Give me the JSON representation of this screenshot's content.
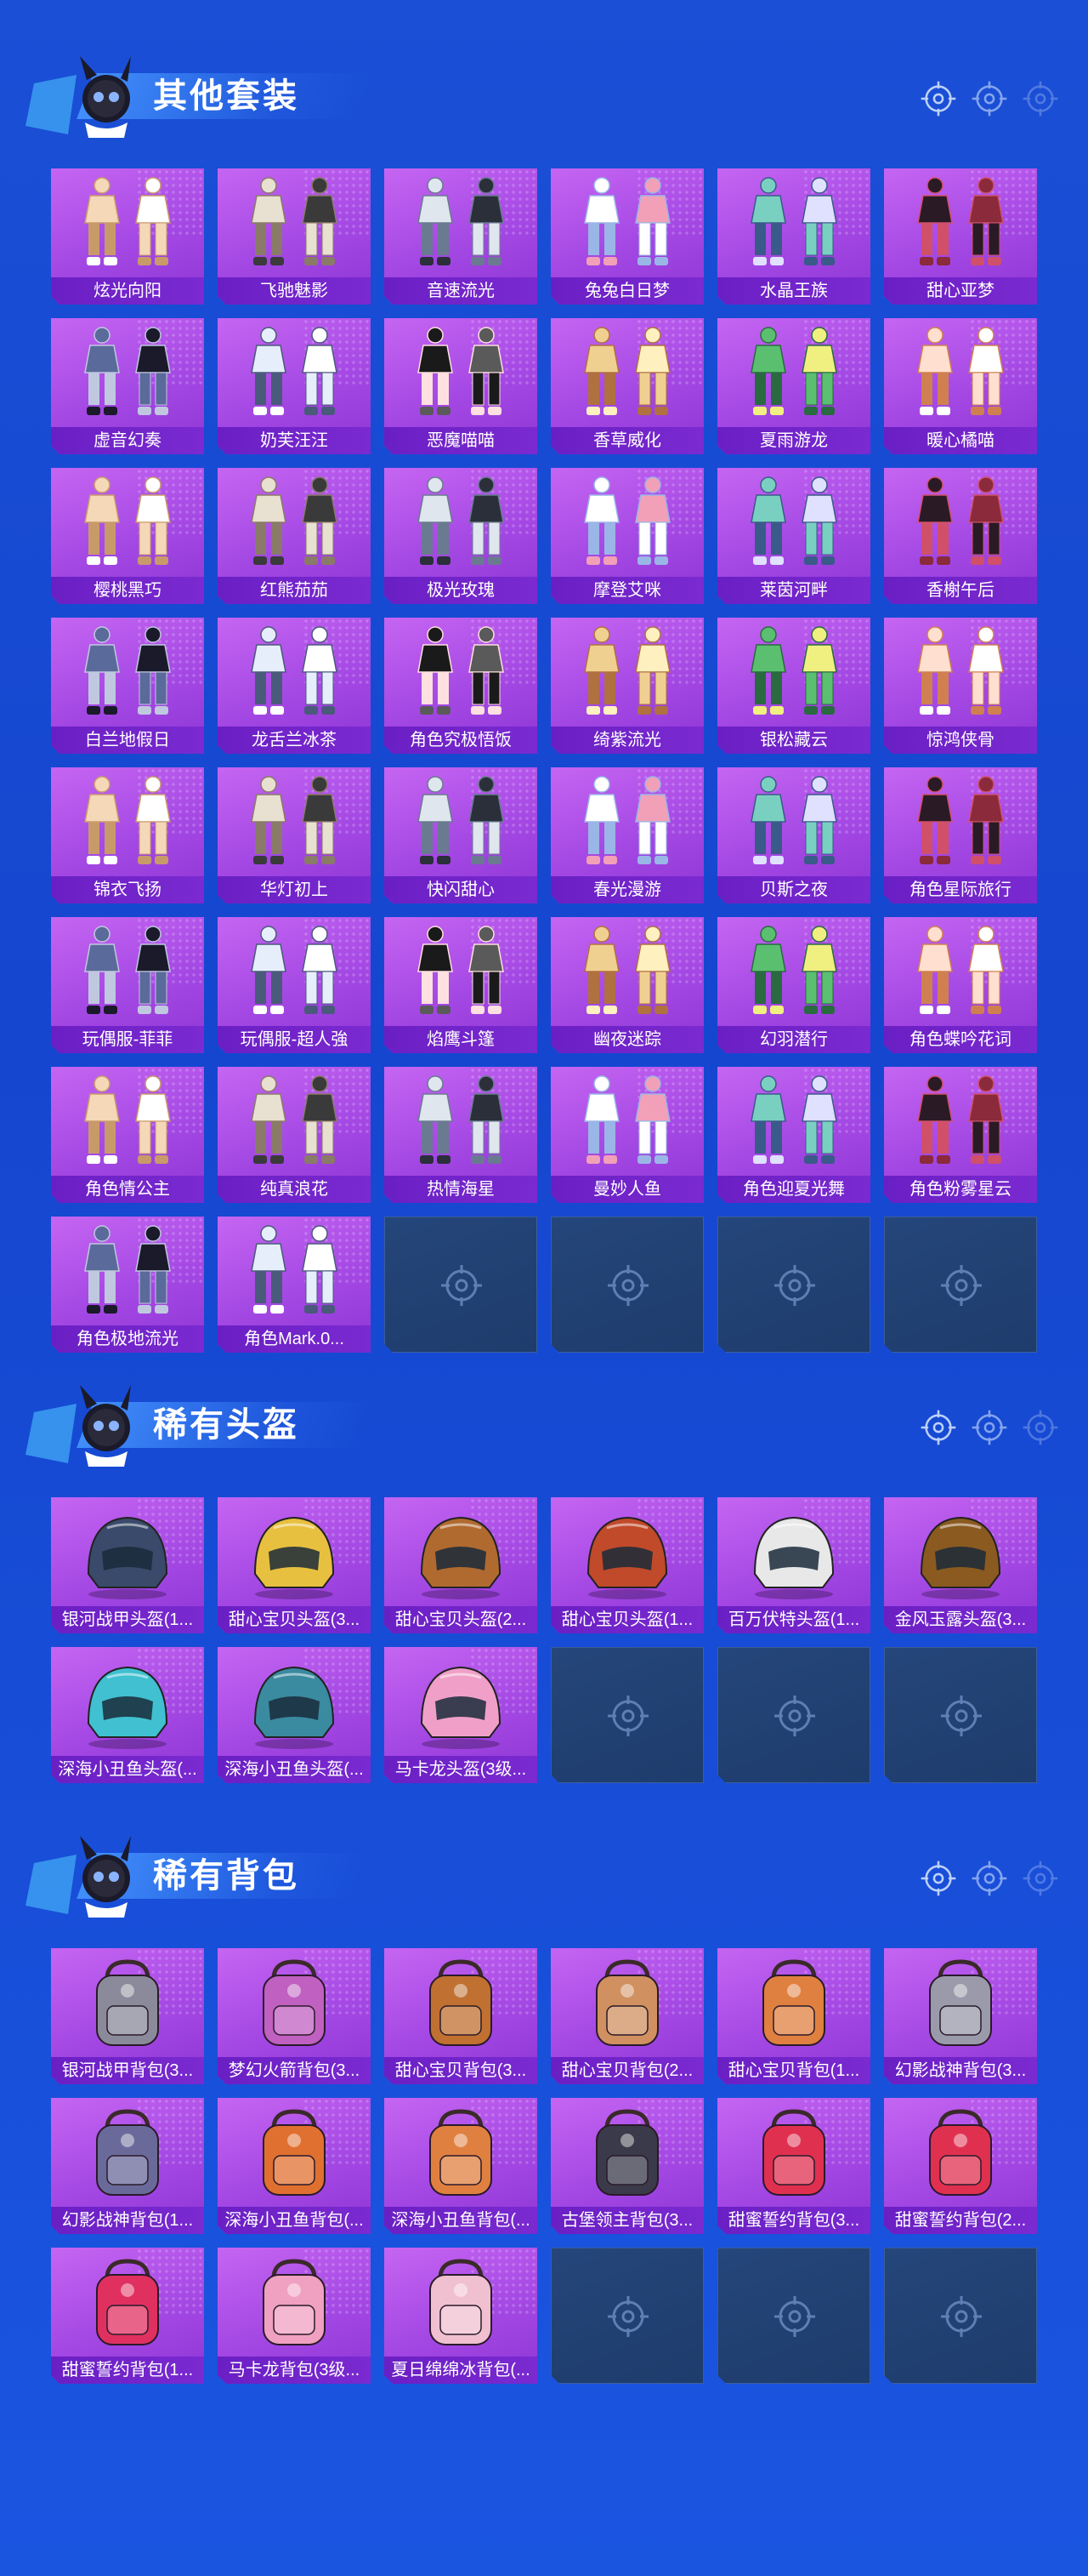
{
  "sections": [
    {
      "title": "其他套装",
      "kind": "outfit",
      "items": [
        "炫光向阳",
        "飞驰魅影",
        "音速流光",
        "兔兔白日梦",
        "水晶王族",
        "甜心亚梦",
        "虚音幻奏",
        "奶芙汪汪",
        "恶魔喵喵",
        "香草威化",
        "夏雨游龙",
        "暖心橘喵",
        "樱桃黑巧",
        "红熊茄茄",
        "极光玫瑰",
        "摩登艾咪",
        "莱茵河畔",
        "香榭午后",
        "白兰地假日",
        "龙舌兰冰茶",
        "角色究极悟饭",
        "绮紫流光",
        "银松藏云",
        "惊鸿侠骨",
        "锦衣飞扬",
        "华灯初上",
        "快闪甜心",
        "春光漫游",
        "贝斯之夜",
        "角色星际旅行",
        "玩偶服-菲菲",
        "玩偶服-超人強",
        "焰鹰斗篷",
        "幽夜迷踪",
        "幻羽潜行",
        "角色蝶吟花词",
        "角色情公主",
        "纯真浪花",
        "热情海星",
        "曼妙人鱼",
        "角色迎夏光舞",
        "角色粉雾星云",
        "角色极地流光",
        "角色Mark.0..."
      ],
      "empty_slots": 4
    },
    {
      "title": "稀有头盔",
      "kind": "helmet",
      "items": [
        "银河战甲头盔(1...",
        "甜心宝贝头盔(3...",
        "甜心宝贝头盔(2...",
        "甜心宝贝头盔(1...",
        "百万伏特头盔(1...",
        "金风玉露头盔(3...",
        "深海小丑鱼头盔(...",
        "深海小丑鱼头盔(...",
        "马卡龙头盔(3级..."
      ],
      "empty_slots": 3
    },
    {
      "title": "稀有背包",
      "kind": "backpack",
      "items": [
        "银河战甲背包(3...",
        "梦幻火箭背包(3...",
        "甜心宝贝背包(3...",
        "甜心宝贝背包(2...",
        "甜心宝贝背包(1...",
        "幻影战神背包(3...",
        "幻影战神背包(1...",
        "深海小丑鱼背包(...",
        "深海小丑鱼背包(...",
        "古堡领主背包(3...",
        "甜蜜誓约背包(3...",
        "甜蜜誓约背包(2...",
        "甜蜜誓约背包(1...",
        "马卡龙背包(3级...",
        "夏日绵绵冰背包(..."
      ],
      "empty_slots": 3
    }
  ],
  "colors": {
    "background": "#1a4fd6",
    "item_card": "#a448e4",
    "label_bar": "#6a1fc4",
    "empty_card": "#25467a"
  },
  "icons": {
    "mascot": "mascot-icon",
    "deco": "crosshair-icon",
    "empty": "crosshair-icon"
  }
}
